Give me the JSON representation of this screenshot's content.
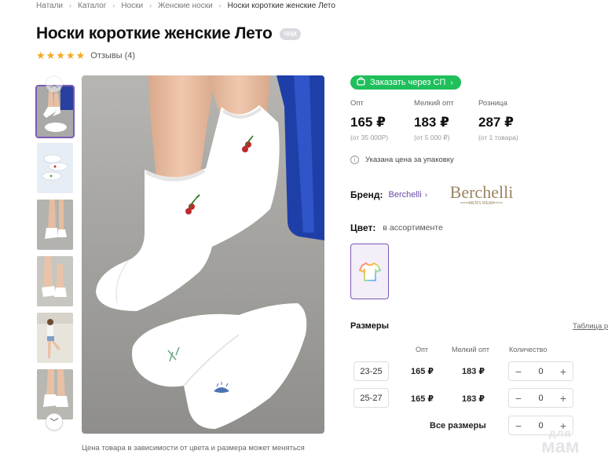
{
  "breadcrumb": [
    "Натали",
    "Каталог",
    "Носки",
    "Женские носки",
    "Носки короткие женские Лето"
  ],
  "product": {
    "title": "Носки короткие женские Лето",
    "badge": "ЧНИ",
    "rating": 5,
    "reviews": "Отзывы (4)"
  },
  "gallery": {
    "thumb_count": 6,
    "active_index": 0,
    "up_icon": "chevron-up-icon",
    "down_icon": "chevron-down-icon",
    "note": "Цена товара в зависимости от цвета и размера может меняться"
  },
  "order_button": {
    "label": "Заказать через СП",
    "icon": "cart-icon"
  },
  "prices": [
    {
      "label": "Опт",
      "value": "165 ₽",
      "sub": "(от 35 000Р)"
    },
    {
      "label": "Мелкий опт",
      "value": "183 ₽",
      "sub": "(от 5 000 ₽)"
    },
    {
      "label": "Розница",
      "value": "287 ₽",
      "sub": "(от 1 товара)"
    }
  ],
  "pack_note": "Указана цена за упаковку",
  "brand": {
    "label": "Бренд:",
    "name": "Berchelli",
    "logo_text": "Berchelli",
    "logo_sub": "MEN'S WEAR"
  },
  "color": {
    "label": "Цвет:",
    "value": "в ассортименте"
  },
  "sizes": {
    "title": "Размеры",
    "table_link": "Таблица р",
    "headers": [
      "Опт",
      "Мелкий опт",
      "Количество"
    ],
    "rows": [
      {
        "size": "23-25",
        "opt": "165 ₽",
        "small_opt": "183 ₽",
        "qty": "0"
      },
      {
        "size": "25-27",
        "opt": "165 ₽",
        "small_opt": "183 ₽",
        "qty": "0"
      }
    ],
    "all_label": "Все размеры",
    "all_qty": "0"
  },
  "watermark": {
    "line1": "для",
    "line2": "мам"
  },
  "colors": {
    "accent": "#7c59b6",
    "green": "#1fbf5b",
    "star": "#f3a91f",
    "link": "#6b4da6"
  }
}
